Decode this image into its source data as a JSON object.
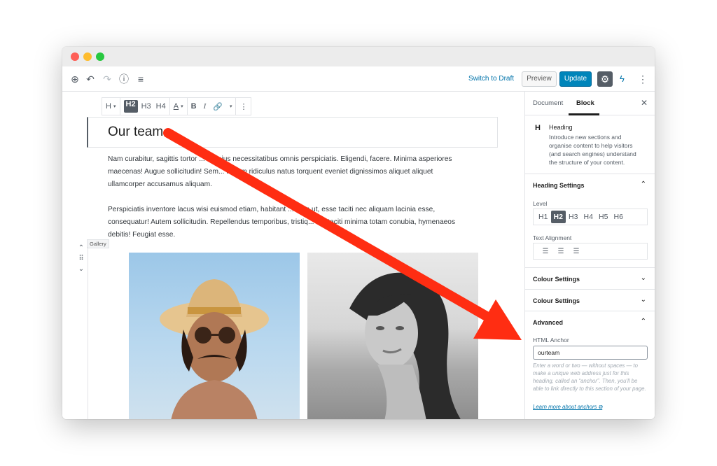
{
  "toolbar": {
    "switch_to_draft": "Switch to Draft",
    "preview": "Preview",
    "update": "Update"
  },
  "block_toolbar": {
    "heading_type": "H",
    "levels": [
      "H2",
      "H3",
      "H4"
    ],
    "text_color": "A",
    "bold": "B",
    "italic": "I"
  },
  "editor": {
    "heading": "Our team",
    "paragraph1": "Nam curabitur, sagittis tortor ... illo eius necessitatibus omnis perspiciatis. Eligendi, facere. Minima asperiores maecenas! Augue sollicitudin! Sem... is sem ridiculus natus torquent eveniet dignissimos aliquet aliquet ullamcorper accusamus aliquam.",
    "paragraph2": "Perspiciatis inventore lacus wisi euismod etiam, habitant ... dum ut, esse taciti nec aliquam lacinia esse, consequatur! Autem sollicitudin. Repellendus temporibus, tristiq... rcu taciti minima totam conubia, hymenaeos debitis! Feugiat esse.",
    "gallery_label": "Gallery"
  },
  "sidebar": {
    "tabs": [
      "Document",
      "Block"
    ],
    "block_icon": "H",
    "block_title": "Heading",
    "block_description": "Introduce new sections and organise content to help visitors (and search engines) understand the structure of your content.",
    "heading_settings": "Heading Settings",
    "level_label": "Level",
    "levels": [
      "H1",
      "H2",
      "H3",
      "H4",
      "H5",
      "H6"
    ],
    "active_level": "H2",
    "text_alignment_label": "Text Alignment",
    "colour_settings_1": "Colour Settings",
    "colour_settings_2": "Colour Settings",
    "advanced": "Advanced",
    "html_anchor_label": "HTML Anchor",
    "html_anchor_value": "ourteam",
    "help_text": "Enter a word or two — without spaces — to make a unique web address just for this heading, called an “anchor”. Then, you'll be able to link directly to this section of your page.",
    "learn_more": "Learn more about anchors"
  },
  "colors": {
    "accent": "#0085ba",
    "arrow": "#ff2d12",
    "link": "#0073aa"
  }
}
